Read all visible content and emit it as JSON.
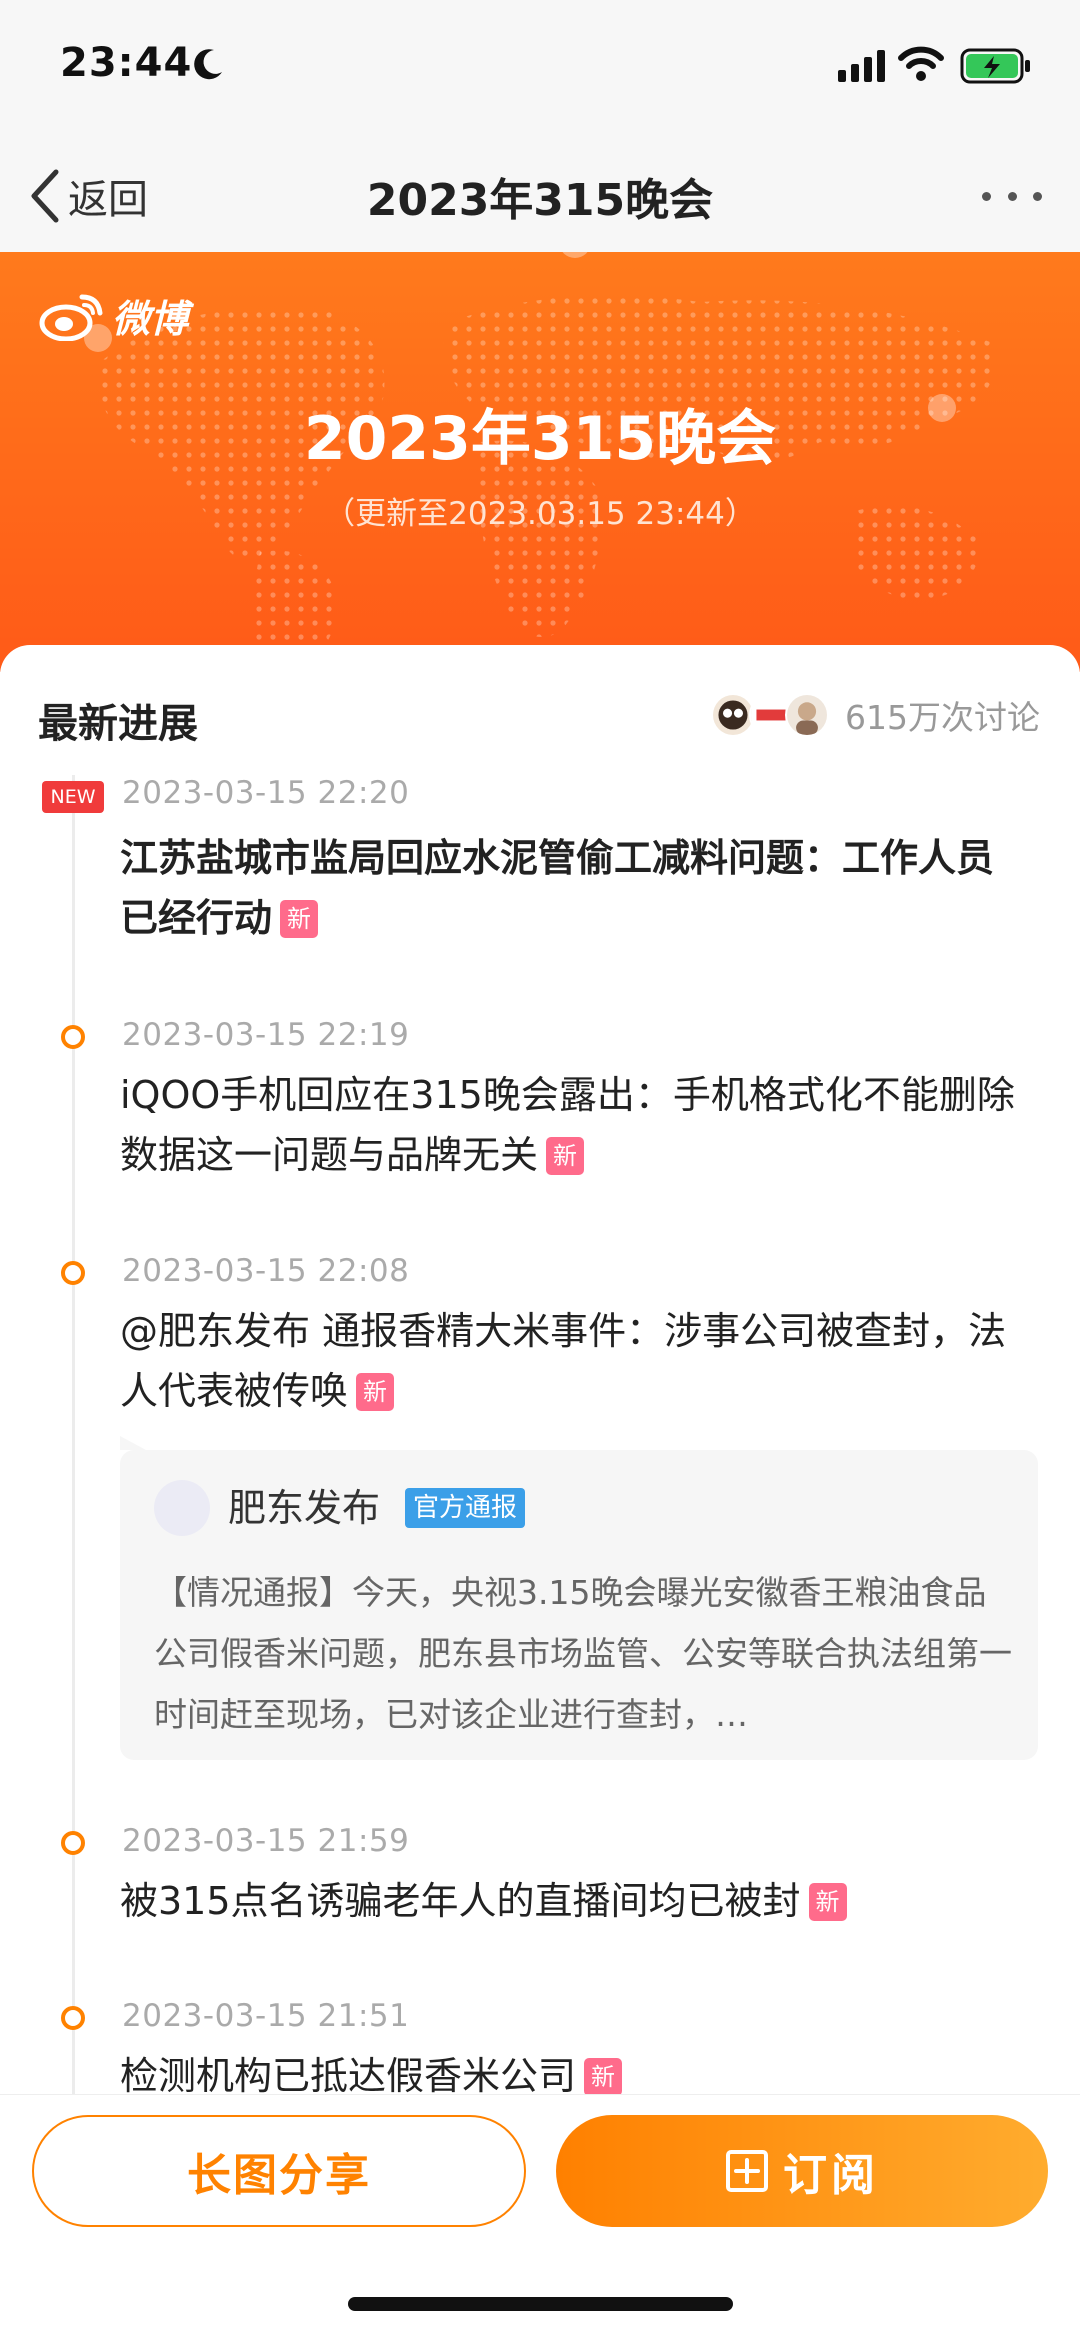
{
  "status_bar": {
    "time": "23:44"
  },
  "nav": {
    "back_label": "返回",
    "title": "2023年315晚会"
  },
  "banner": {
    "logo_text": "微博",
    "title": "2023年315晚会",
    "subtitle": "（更新至2023.03.15 23:44）"
  },
  "section": {
    "title": "最新进展",
    "discussion_count": "615万次讨论"
  },
  "timeline": [
    {
      "time": "2023-03-15 22:20",
      "text": "江苏盐城市监局回应水泥管偷工减料问题：工作人员已经行动",
      "badge": "NEW",
      "tag": "新"
    },
    {
      "time": "2023-03-15 22:19",
      "text": "iQOO手机回应在315晚会露出：手机格式化不能删除数据这一问题与品牌无关",
      "tag": "新"
    },
    {
      "time": "2023-03-15 22:08",
      "text": "@肥东发布 通报香精大米事件：涉事公司被查封，法人代表被传唤",
      "tag": "新"
    },
    {
      "time": "2023-03-15 21:59",
      "text": "被315点名诱骗老年人的直播间均已被封",
      "tag": "新"
    },
    {
      "time": "2023-03-15 21:51",
      "text": "检测机构已抵达假香米公司",
      "tag": "新"
    }
  ],
  "repost": {
    "author": "肥东发布",
    "official_tag": "官方通报",
    "body": "【情况通报】今天，央视3.15晚会曝光安徽香王粮油食品公司假香米问题，肥东县市场监管、公安等联合执法组第一时间赶至现场，已对该企业进行查封，…"
  },
  "bottom": {
    "share_label": "长图分享",
    "subscribe_label": "订阅"
  },
  "colors": {
    "accent": "#ff8200",
    "new_badge": "#f03b3b",
    "xin_tag": "#ff6b8b",
    "official_tag": "#3b9fe8"
  }
}
